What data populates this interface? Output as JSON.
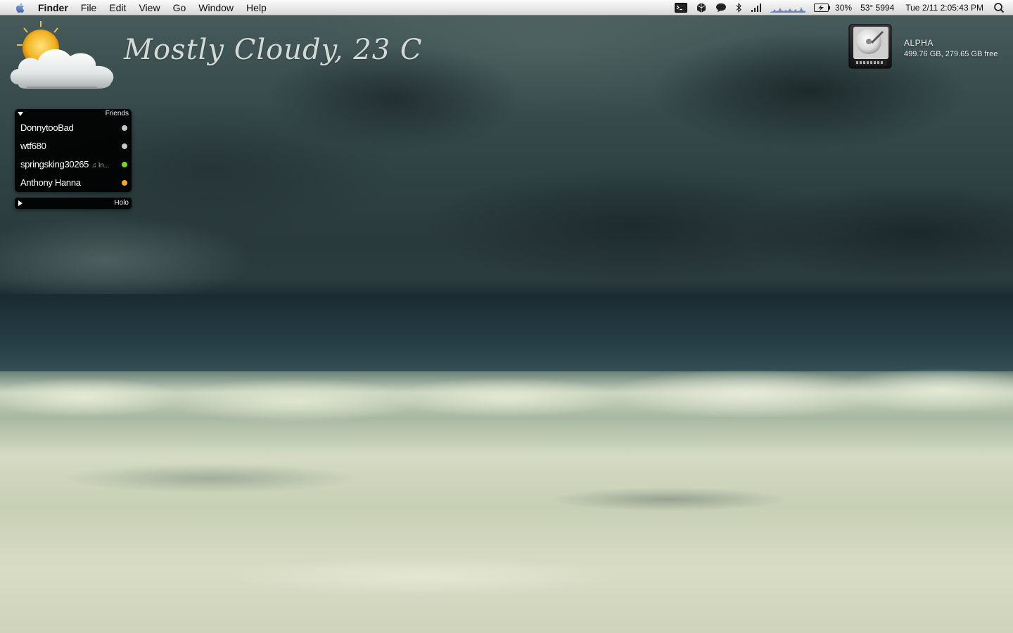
{
  "menubar": {
    "app_name": "Finder",
    "items": [
      "File",
      "Edit",
      "View",
      "Go",
      "Window",
      "Help"
    ],
    "status": {
      "battery_percent": "30%",
      "temperature": "53° 5994",
      "datetime": "Tue 2/11  2:05:43 PM"
    }
  },
  "weather": {
    "condition_text": "Mostly Cloudy, 23 C"
  },
  "drive": {
    "name": "ALPHA",
    "info": "499.76 GB, 279.65 GB free"
  },
  "buddy_list": {
    "friends_group": {
      "title": "Friends",
      "buddies": [
        {
          "name": "DonnytooBad",
          "status_msg": "",
          "status_color": "#c8c8c8"
        },
        {
          "name": "wtf680",
          "status_msg": "",
          "status_color": "#c8c8c8"
        },
        {
          "name": "springsking30265",
          "status_msg": "♫ In...",
          "status_color": "#7ed321"
        },
        {
          "name": "Anthony Hanna",
          "status_msg": "",
          "status_color": "#f5a623"
        }
      ]
    },
    "holo_group": {
      "title": "Holo"
    }
  }
}
